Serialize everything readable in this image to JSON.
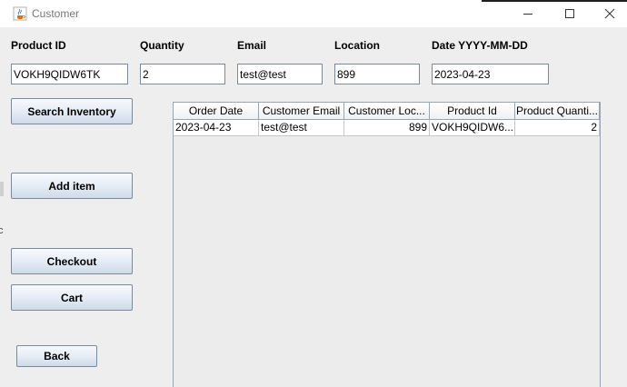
{
  "window": {
    "title": "Customer",
    "app_icon": "java-cup-icon"
  },
  "form": {
    "product_id": {
      "label": "Product ID",
      "value": "VOKH9QIDW6TK"
    },
    "quantity": {
      "label": "Quantity",
      "value": "2"
    },
    "email": {
      "label": "Email",
      "value": "test@test"
    },
    "location": {
      "label": "Location",
      "value": "899"
    },
    "date": {
      "label": "Date YYYY-MM-DD",
      "value": "2023-04-23"
    }
  },
  "buttons": {
    "search_inventory": "Search Inventory",
    "add_item": "Add item",
    "checkout": "Checkout",
    "cart": "Cart",
    "back": "Back"
  },
  "table": {
    "columns": [
      "Order Date",
      "Customer Email",
      "Customer Loc...",
      "Product Id",
      "Product Quanti..."
    ],
    "rows": [
      [
        "2023-04-23",
        "test@test",
        "899",
        "VOKH9QIDW6...",
        "2"
      ]
    ]
  },
  "background_window_fragment": "c"
}
